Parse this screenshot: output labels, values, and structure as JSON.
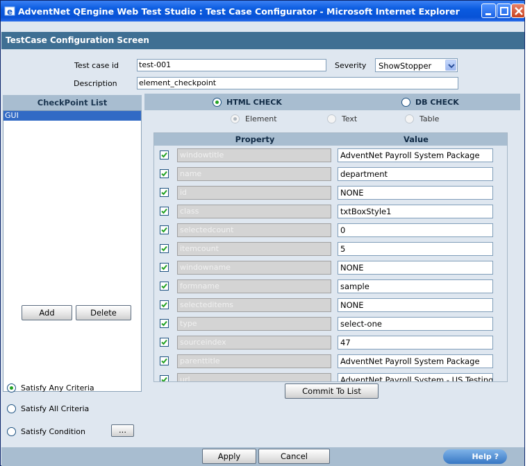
{
  "window": {
    "title": "AdventNet QEngine Web Test Studio : Test Case Configurator - Microsoft Internet Explorer"
  },
  "screen": {
    "heading": "TestCase Configuration Screen"
  },
  "form": {
    "testcase_id_label": "Test case id",
    "testcase_id_value": "test-001",
    "severity_label": "Severity",
    "severity_value": "ShowStopper",
    "description_label": "Description",
    "description_value": "element_checkpoint"
  },
  "checkpoint_list": {
    "heading": "CheckPoint List",
    "items": [
      "GUI"
    ],
    "add_label": "Add",
    "delete_label": "Delete"
  },
  "criteria": {
    "options": [
      {
        "label": "Satisfy Any Criteria",
        "selected": true
      },
      {
        "label": "Satisfy All Criteria",
        "selected": false
      },
      {
        "label": "Satisfy Condition",
        "selected": false
      }
    ],
    "condition_button_label": "..."
  },
  "check_type": {
    "html_label": "HTML CHECK",
    "db_label": "DB CHECK",
    "selected": "html"
  },
  "sub_type": {
    "element_label": "Element",
    "text_label": "Text",
    "table_label": "Table",
    "selected": "element"
  },
  "grid": {
    "property_header": "Property",
    "value_header": "Value",
    "rows": [
      {
        "property": "windowtitle",
        "value": "AdventNet Payroll System Package",
        "checked": true
      },
      {
        "property": "name",
        "value": "department",
        "checked": true
      },
      {
        "property": "id",
        "value": "NONE",
        "checked": true
      },
      {
        "property": "class",
        "value": "txtBoxStyle1",
        "checked": true
      },
      {
        "property": "selectedcount",
        "value": "0",
        "checked": true
      },
      {
        "property": "itemcount",
        "value": "5",
        "checked": true
      },
      {
        "property": "windowname",
        "value": "NONE",
        "checked": true
      },
      {
        "property": "formname",
        "value": "sample",
        "checked": true
      },
      {
        "property": "selecteditems",
        "value": "NONE",
        "checked": true
      },
      {
        "property": "type",
        "value": "select-one",
        "checked": true
      },
      {
        "property": "sourceindex",
        "value": "47",
        "checked": true
      },
      {
        "property": "parenttitle",
        "value": "AdventNet Payroll System Package",
        "checked": true
      },
      {
        "property": "url",
        "value": "AdventNet Payroll System - US Testing",
        "checked": true
      }
    ]
  },
  "commit_label": "Commit To List",
  "footer": {
    "apply_label": "Apply",
    "cancel_label": "Cancel",
    "help_label": "Help ?"
  },
  "colors": {
    "titlebar": "#0a5be0",
    "header_band": "#3f6f93",
    "panel_head": "#a8bdd0",
    "body_bg": "#dfe7f0",
    "selection": "#316ac5"
  }
}
